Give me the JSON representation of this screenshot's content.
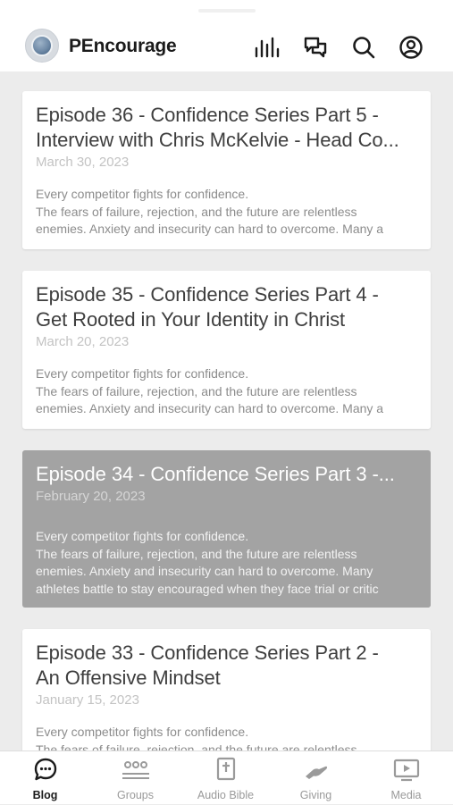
{
  "header": {
    "app_title": "PEncourage",
    "icons": [
      "app-logo",
      "stats-bars-icon",
      "chat-bubbles-icon",
      "search-icon",
      "account-icon"
    ]
  },
  "posts": [
    {
      "title": "Episode 36 - Confidence Series Part 5 - Interview with Chris McKelvie - Head Co...",
      "title_line1": "Episode 36 - Confidence Series Part 5 -",
      "title_line2": "Interview with Chris McKelvie - Head Co...",
      "date": "March 30, 2023",
      "excerpt": [
        "Every competitor fights for confidence.",
        "The fears of failure, rejection, and the future are relentless",
        "enemies. Anxiety and insecurity can hard to overcome. Many a"
      ],
      "selected": false
    },
    {
      "title_line1": "Episode 35 - Confidence Series Part 4 -",
      "title_line2": "Get Rooted in Your Identity in Christ",
      "date": "March 20, 2023",
      "excerpt": [
        "Every competitor fights for confidence.",
        "The fears of failure, rejection, and the future are relentless",
        "enemies. Anxiety and insecurity can hard to overcome. Many a"
      ],
      "selected": false
    },
    {
      "title_line1": "Episode 34 - Confidence Series Part 3 -...",
      "date": "February 20, 2023",
      "excerpt": [
        "Every competitor fights for confidence.",
        "The fears of failure, rejection, and the future are relentless",
        "enemies. Anxiety and insecurity can hard to overcome. Many",
        "athletes battle to stay encouraged when they face trial or critic"
      ],
      "selected": true
    },
    {
      "title_line1": "Episode 33 - Confidence Series Part 2 -",
      "title_line2": "An Offensive Mindset",
      "date": "January 15, 2023",
      "excerpt": [
        "Every competitor fights for confidence.",
        "The fears of failure, rejection, and the future are relentless"
      ],
      "selected": false
    }
  ],
  "tabs": [
    {
      "label": "Blog",
      "icon": "blog-chat-icon",
      "active": true
    },
    {
      "label": "Groups",
      "icon": "groups-icon",
      "active": false
    },
    {
      "label": "Audio Bible",
      "icon": "audio-bible-icon",
      "active": false
    },
    {
      "label": "Giving",
      "icon": "giving-icon",
      "active": false
    },
    {
      "label": "Media",
      "icon": "media-icon",
      "active": false
    }
  ],
  "colors": {
    "background": "#ececec",
    "card": "#ffffff",
    "selected_card": "#a3a3a3",
    "active_tab": "#1b1b1b",
    "inactive_tab": "#9a9a9a"
  }
}
